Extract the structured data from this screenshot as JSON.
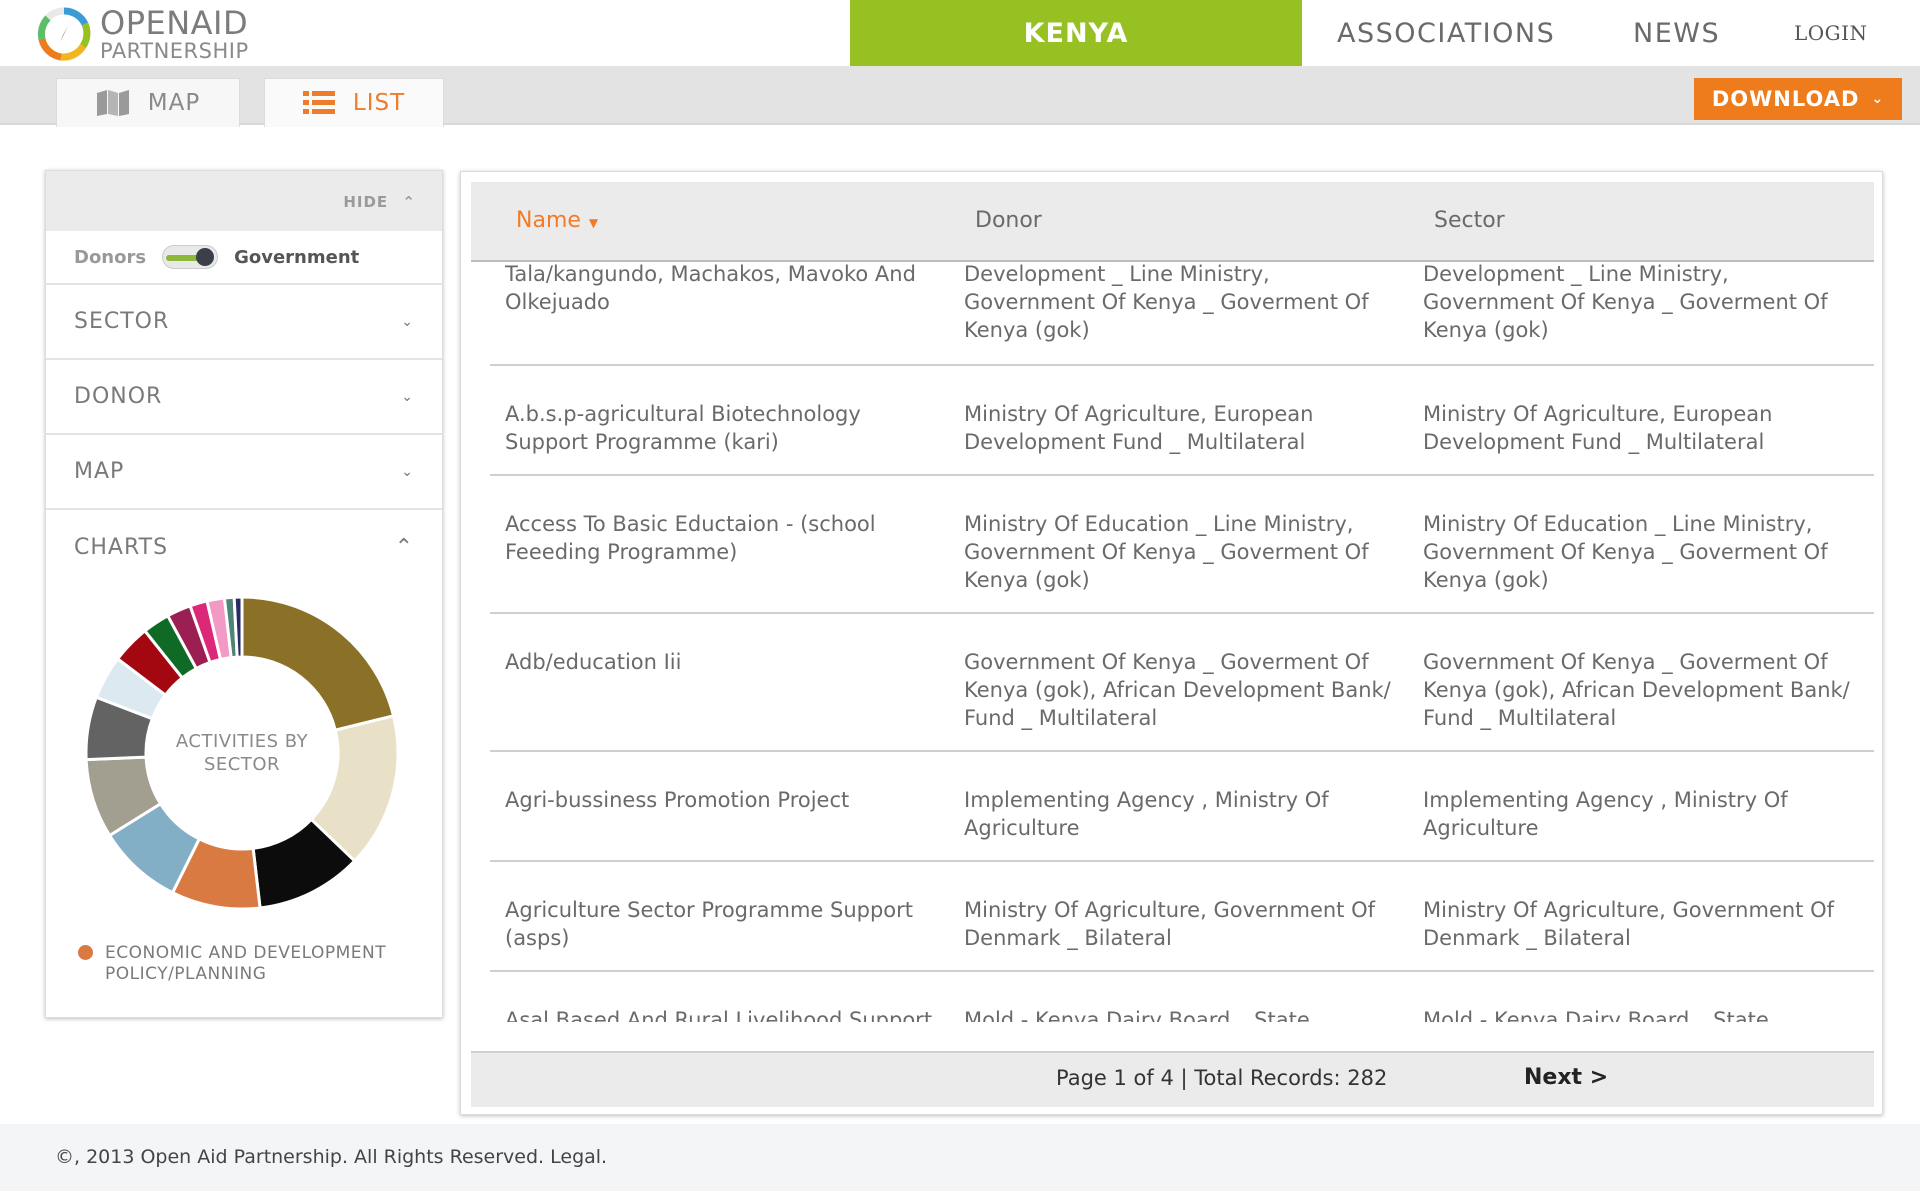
{
  "header": {
    "logo_line1": "OPENAID",
    "logo_line2": "PARTNERSHIP",
    "nav_country": "KENYA",
    "nav_associations": "ASSOCIATIONS",
    "nav_news": "NEWS",
    "nav_login": "LOGIN",
    "accent_color": "#97c023"
  },
  "tabs": {
    "map_label": "MAP",
    "list_label": "LIST",
    "download_label": "DOWNLOAD",
    "download_color": "#ef7c1c"
  },
  "sidebar": {
    "hide_label": "HIDE",
    "toggle_left": "Donors",
    "toggle_right": "Government",
    "filters": [
      "SECTOR",
      "DONOR",
      "MAP"
    ],
    "charts_label": "CHARTS",
    "chart_center_line1": "ACTIVITIES BY",
    "chart_center_line2": "SECTOR",
    "legend_label_line1": "ECONOMIC AND DEVELOPMENT",
    "legend_label_line2": "POLICY/PLANNING"
  },
  "chart_data": {
    "type": "pie",
    "title": "ACTIVITIES BY SECTOR",
    "values": [
      21.2,
      16.0,
      11.0,
      9.2,
      8.8,
      8.2,
      6.5,
      4.5,
      4.0,
      2.8,
      2.5,
      1.8,
      1.8,
      1.0,
      0.8
    ],
    "colors": [
      "#8b7127",
      "#e8e0c7",
      "#0c0c0c",
      "#d97a43",
      "#82afc6",
      "#a29e90",
      "#636363",
      "#dde9f0",
      "#a30710",
      "#0f6a25",
      "#9b1f53",
      "#dd2879",
      "#f299c5",
      "#4f8375",
      "#2a2a65"
    ],
    "legend": [
      "ECONOMIC AND DEVELOPMENT POLICY/PLANNING"
    ]
  },
  "table": {
    "headers": {
      "name": "Name",
      "donor": "Donor",
      "sector": "Sector"
    },
    "rows": [
      {
        "name": "Tala/kangundo, Machakos, Mavoko And Olkejuado",
        "donor": "Development _ Line Ministry, Government Of Kenya _ Goverment Of Kenya (gok)",
        "sector": "Development _ Line Ministry, Government Of Kenya _ Goverment Of Kenya (gok)"
      },
      {
        "name": "A.b.s.p-agricultural Biotechnology Support Programme (kari)",
        "donor": "Ministry Of Agriculture, European Development Fund _ Multilateral",
        "sector": "Ministry Of Agriculture, European Development Fund _ Multilateral"
      },
      {
        "name": "Access To Basic Eductaion - (school Feeeding Programme)",
        "donor": "Ministry Of Education _ Line Ministry, Government Of Kenya _ Goverment Of Kenya (gok)",
        "sector": "Ministry Of Education _ Line Ministry, Government Of Kenya _ Goverment Of Kenya (gok)"
      },
      {
        "name": "Adb/education Iii",
        "donor": "Government Of Kenya _ Goverment Of Kenya (gok), African Development Bank/ Fund _ Multilateral",
        "sector": "Government Of Kenya _ Goverment Of Kenya (gok), African Development Bank/ Fund _ Multilateral"
      },
      {
        "name": "Agri-bussiness Promotion Project",
        "donor": "Implementing Agency , Ministry Of Agriculture",
        "sector": "Implementing Agency , Ministry Of Agriculture"
      },
      {
        "name": "Agriculture Sector Programme Support (asps)",
        "donor": "Ministry Of Agriculture, Government Of Denmark _ Bilateral",
        "sector": "Ministry Of Agriculture, Government Of Denmark _ Bilateral"
      },
      {
        "name": "Asal Based And Rural Livelihood Support Project (allpro)",
        "donor": "Mold - Kenya Dairy Board _ State Corporation, Government Of Kenya",
        "sector": "Mold - Kenya Dairy Board _ State Corporation, Government Of Kenya"
      }
    ],
    "page_info": "Page 1 of 4 | Total Records: 282",
    "next_label": "Next >"
  },
  "footer": {
    "copyright": "©, 2013 Open Aid Partnership. All Rights Reserved. Legal."
  }
}
